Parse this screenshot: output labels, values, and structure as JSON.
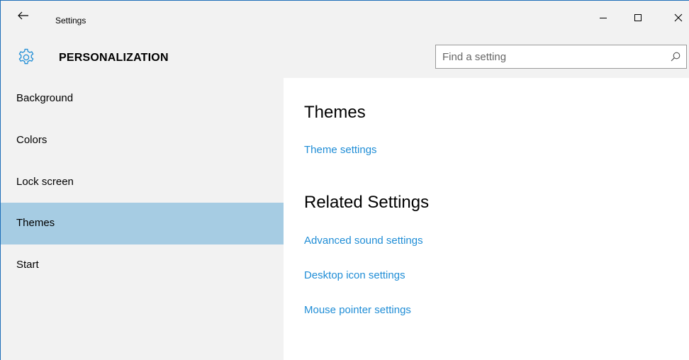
{
  "window": {
    "title": "Settings"
  },
  "header": {
    "section_title": "PERSONALIZATION",
    "search_placeholder": "Find a setting"
  },
  "sidebar": {
    "items": [
      {
        "label": "Background"
      },
      {
        "label": "Colors"
      },
      {
        "label": "Lock screen"
      },
      {
        "label": "Themes"
      },
      {
        "label": "Start"
      }
    ],
    "selected": "Themes"
  },
  "main": {
    "themes_heading": "Themes",
    "theme_settings_link": "Theme settings",
    "related_heading": "Related Settings",
    "related_links": [
      {
        "label": "Advanced sound settings"
      },
      {
        "label": "Desktop icon settings"
      },
      {
        "label": "Mouse pointer settings"
      }
    ]
  },
  "colors": {
    "accent_link": "#1f8dd6",
    "selected_item": "#a6cce3",
    "window_border": "#1e6fb8",
    "sidebar_bg": "#f2f2f2"
  },
  "icons": {
    "back": "back-arrow-icon",
    "minimize": "minimize-icon",
    "maximize": "maximize-icon",
    "close": "close-icon",
    "gear": "gear-icon",
    "search": "search-icon"
  }
}
